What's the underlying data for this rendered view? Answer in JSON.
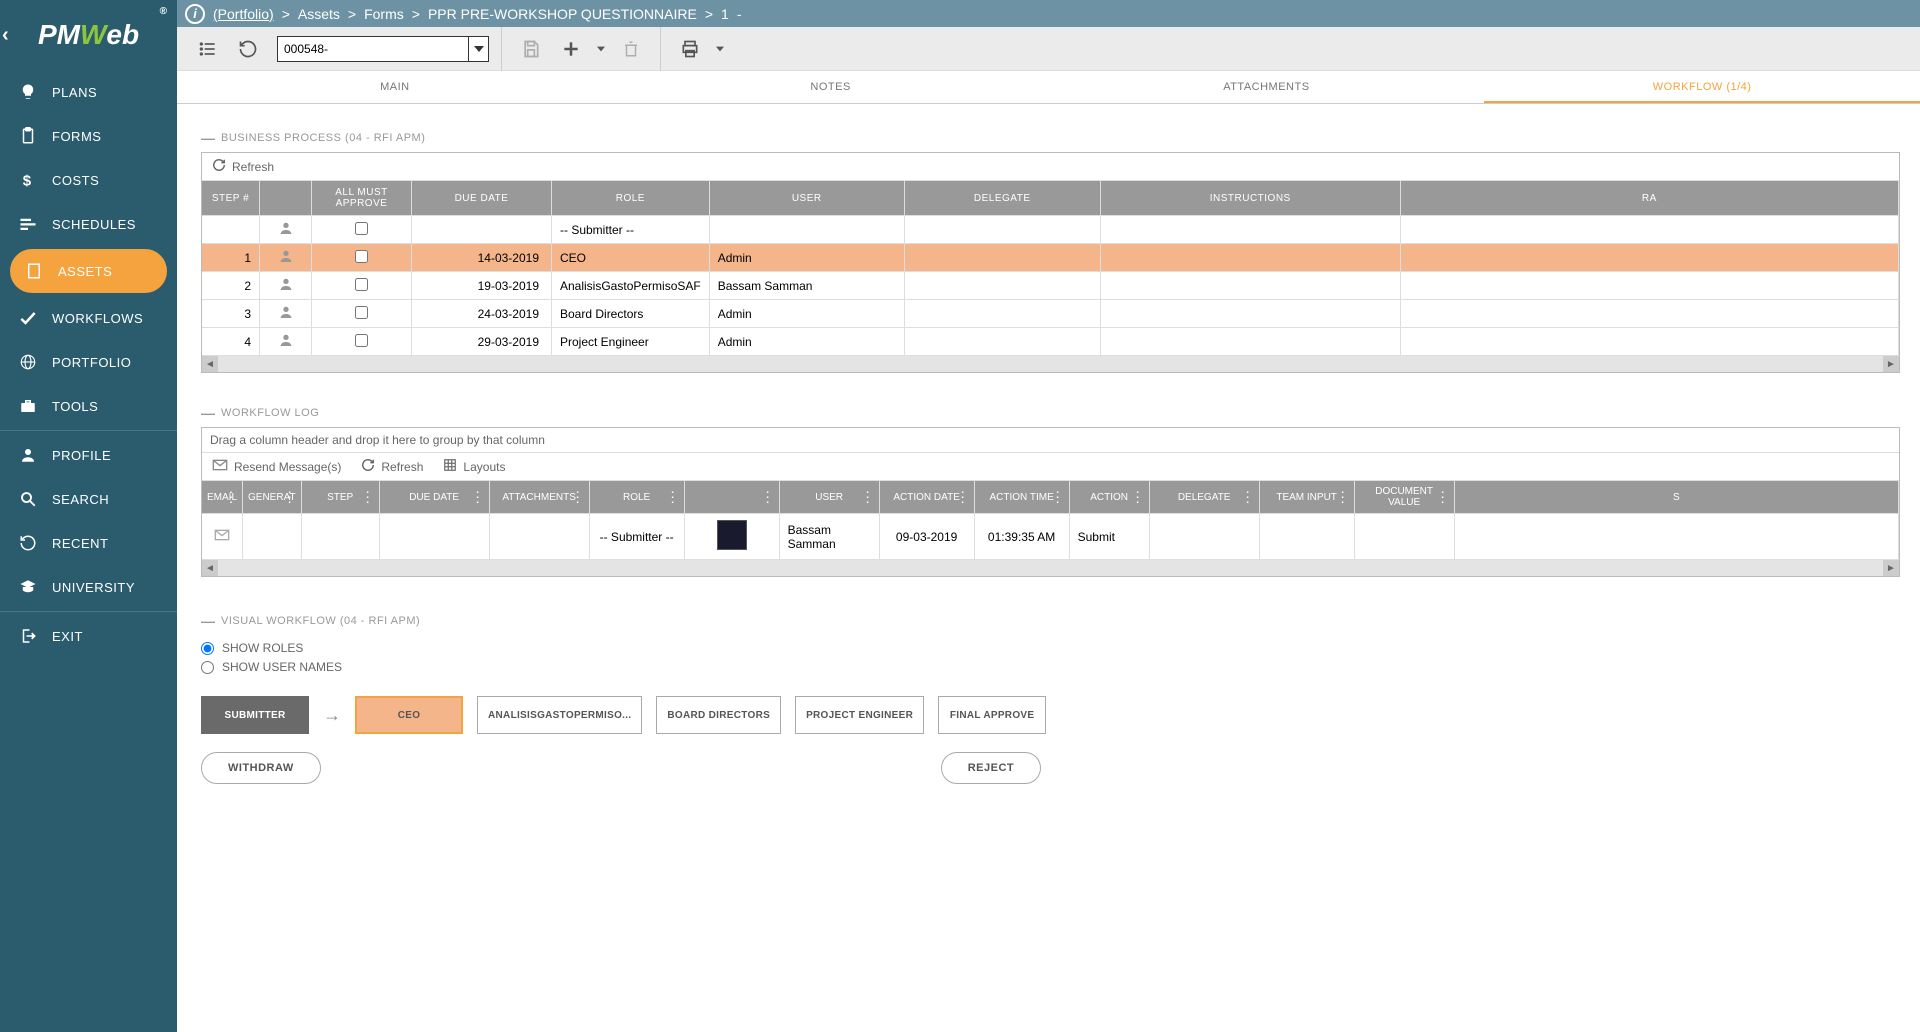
{
  "breadcrumb": {
    "portfolio": "(Portfolio)",
    "level1": "Assets",
    "level2": "Forms",
    "level3": "PPR PRE-WORKSHOP QUESTIONNAIRE",
    "level4": "1",
    "level5": "-"
  },
  "toolbar": {
    "record_id": "000548-"
  },
  "sidebar": {
    "items": [
      {
        "label": "PLANS"
      },
      {
        "label": "FORMS"
      },
      {
        "label": "COSTS"
      },
      {
        "label": "SCHEDULES"
      },
      {
        "label": "ASSETS"
      },
      {
        "label": "WORKFLOWS"
      },
      {
        "label": "PORTFOLIO"
      },
      {
        "label": "TOOLS"
      },
      {
        "label": "PROFILE"
      },
      {
        "label": "SEARCH"
      },
      {
        "label": "RECENT"
      },
      {
        "label": "UNIVERSITY"
      },
      {
        "label": "EXIT"
      }
    ]
  },
  "tabs": {
    "main": "MAIN",
    "notes": "NOTES",
    "attachments": "ATTACHMENTS",
    "workflow": "WORKFLOW (1/4)"
  },
  "bp": {
    "title": "BUSINESS PROCESS (04 - RFI APM)",
    "refresh": "Refresh",
    "headers": {
      "step": "STEP #",
      "blank": "",
      "all_approve": "ALL MUST APPROVE",
      "due_date": "DUE DATE",
      "role": "ROLE",
      "user": "USER",
      "delegate": "DELEGATE",
      "instructions": "INSTRUCTIONS",
      "ra": "RA"
    },
    "rows": [
      {
        "step": "",
        "due": "",
        "role": "-- Submitter --",
        "user": "",
        "delegate": "",
        "instructions": ""
      },
      {
        "step": "1",
        "due": "14-03-2019",
        "role": "CEO",
        "user": "Admin",
        "delegate": "",
        "instructions": ""
      },
      {
        "step": "2",
        "due": "19-03-2019",
        "role": "AnalisisGastoPermisoSAF",
        "user": "Bassam Samman",
        "delegate": "",
        "instructions": ""
      },
      {
        "step": "3",
        "due": "24-03-2019",
        "role": "Board Directors",
        "user": "Admin",
        "delegate": "",
        "instructions": ""
      },
      {
        "step": "4",
        "due": "29-03-2019",
        "role": "Project Engineer",
        "user": "Admin",
        "delegate": "",
        "instructions": ""
      }
    ]
  },
  "wflog": {
    "title": "WORKFLOW LOG",
    "group_hint": "Drag a column header and drop it here to group by that column",
    "resend": "Resend Message(s)",
    "refresh": "Refresh",
    "layouts": "Layouts",
    "headers": {
      "email": "EMAIL",
      "generate": "GENERAT",
      "step": "STEP",
      "due_date": "DUE DATE",
      "attachments": "ATTACHMENTS",
      "role": "ROLE",
      "avatar": "",
      "user": "USER",
      "action_date": "ACTION DATE",
      "action_time": "ACTION TIME",
      "action": "ACTION",
      "delegate": "DELEGATE",
      "team_input": "TEAM INPUT",
      "doc_value": "DOCUMENT VALUE",
      "s": "S"
    },
    "rows": [
      {
        "email": "",
        "generate": "",
        "step": "",
        "due_date": "",
        "attachments": "",
        "role": "-- Submitter --",
        "user": "Bassam Samman",
        "action_date": "09-03-2019",
        "action_time": "01:39:35 AM",
        "action": "Submit",
        "delegate": "",
        "team_input": "",
        "doc_value": ""
      }
    ]
  },
  "visual": {
    "title": "VISUAL WORKFLOW (04 - RFI APM)",
    "show_roles": "SHOW ROLES",
    "show_users": "SHOW USER NAMES",
    "nodes": [
      "SUBMITTER",
      "CEO",
      "ANALISISGASTOPERMISO...",
      "BOARD DIRECTORS",
      "PROJECT ENGINEER",
      "FINAL APPROVE"
    ],
    "withdraw": "WITHDRAW",
    "reject": "REJECT"
  }
}
